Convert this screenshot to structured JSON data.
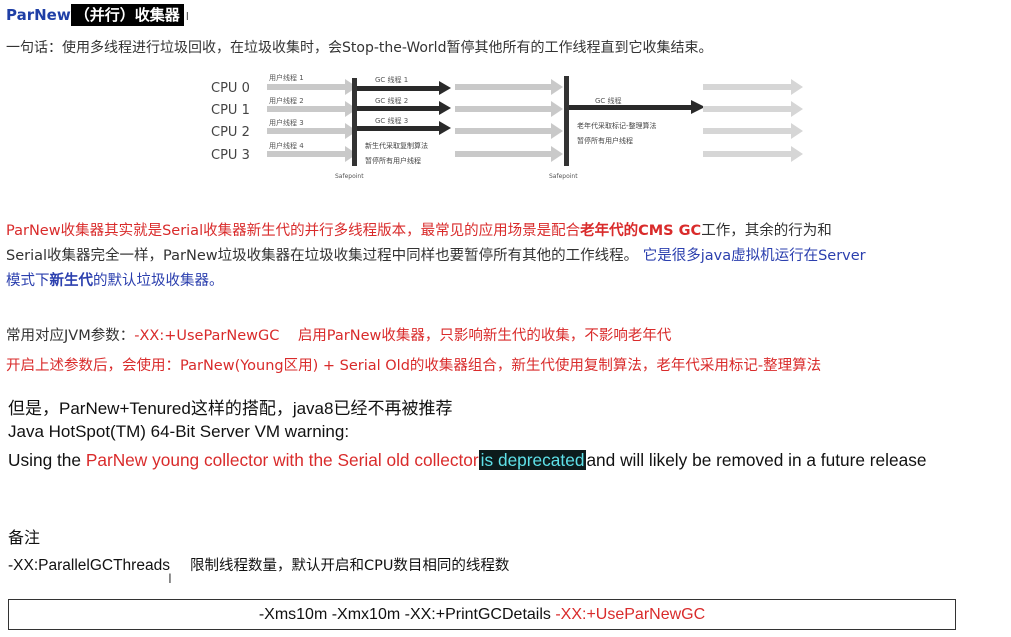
{
  "title": {
    "en": "ParNew",
    "cn": "（并行）收集器",
    "cursor": "I"
  },
  "summary": "一句话：使用多线程进行垃圾回收，在垃圾收集时，会Stop-the-World暂停其他所有的工作线程直到它收集结束。",
  "diagram": {
    "cpus": [
      "CPU 0",
      "CPU 1",
      "CPU 2",
      "CPU 3"
    ],
    "user_thread_labels": [
      "用户线程 1",
      "用户线程 2",
      "用户线程 3",
      "用户线程 4"
    ],
    "gc_thread_labels": [
      "GC 线程 1",
      "GC 线程 2",
      "GC 线程 3"
    ],
    "young_gc_note": [
      "新生代采取复制算法",
      "暂停所有用户线程"
    ],
    "old_gc_label": "GC 线程",
    "old_gc_note": [
      "老年代采取标记-整理算法",
      "暂停所有用户线程"
    ],
    "safepoint_label": "Safepoint"
  },
  "description": {
    "l1_a": "ParNew收集器其实就是Serial收集器新生代的并行多线程版本，最常见的应用场景是配合",
    "l1_b": "老年代的CMS GC",
    "l1_c": "工作，其余的行为和",
    "l2_a": "Serial收集器完全一样，ParNew垃圾收集器在垃圾收集过程中同样也要暂停所有其他的工作线程。",
    "l2_b": "它是很多java虚拟机运行在Server",
    "l3_a": "模式下",
    "l3_b": "新生代",
    "l3_c": "的默认垃圾收集器。"
  },
  "params": {
    "label": "常用对应JVM参数：",
    "flag": "-XX:+UseParNewGC",
    "desc": "启用ParNew收集器，只影响新生代的收集，不影响老年代"
  },
  "enable_line": "开启上述参数后，会使用：ParNew(Young区用) + Serial Old的收集器组合，新生代使用复制算法，老年代采用标记-整理算法",
  "lower": {
    "but_line": "但是，ParNew+Tenured这样的搭配，java8已经不再被推荐",
    "warning_title": "Java HotSpot(TM) 64-Bit Server VM warning:",
    "using_prefix": "Using the ",
    "using_red": "ParNew young collector with the Serial old collector",
    "using_highlight": "is deprecated",
    "using_suffix": "and will likely be removed in a future release",
    "note_label": "备注",
    "threads_flag": "-XX:ParallelGCThreads",
    "threads_desc": "限制线程数量，默认开启和CPU数目相同的线程数",
    "cmd_black": "-Xms10m -Xmx10m -XX:+PrintGCDetails ",
    "cmd_red": "-XX:+UseParNewGC"
  },
  "colors": {
    "red": "#d92b2b",
    "blue": "#2b3fae",
    "highlight_bg": "#0d1b1c",
    "highlight_fg": "#5ee0e8"
  }
}
